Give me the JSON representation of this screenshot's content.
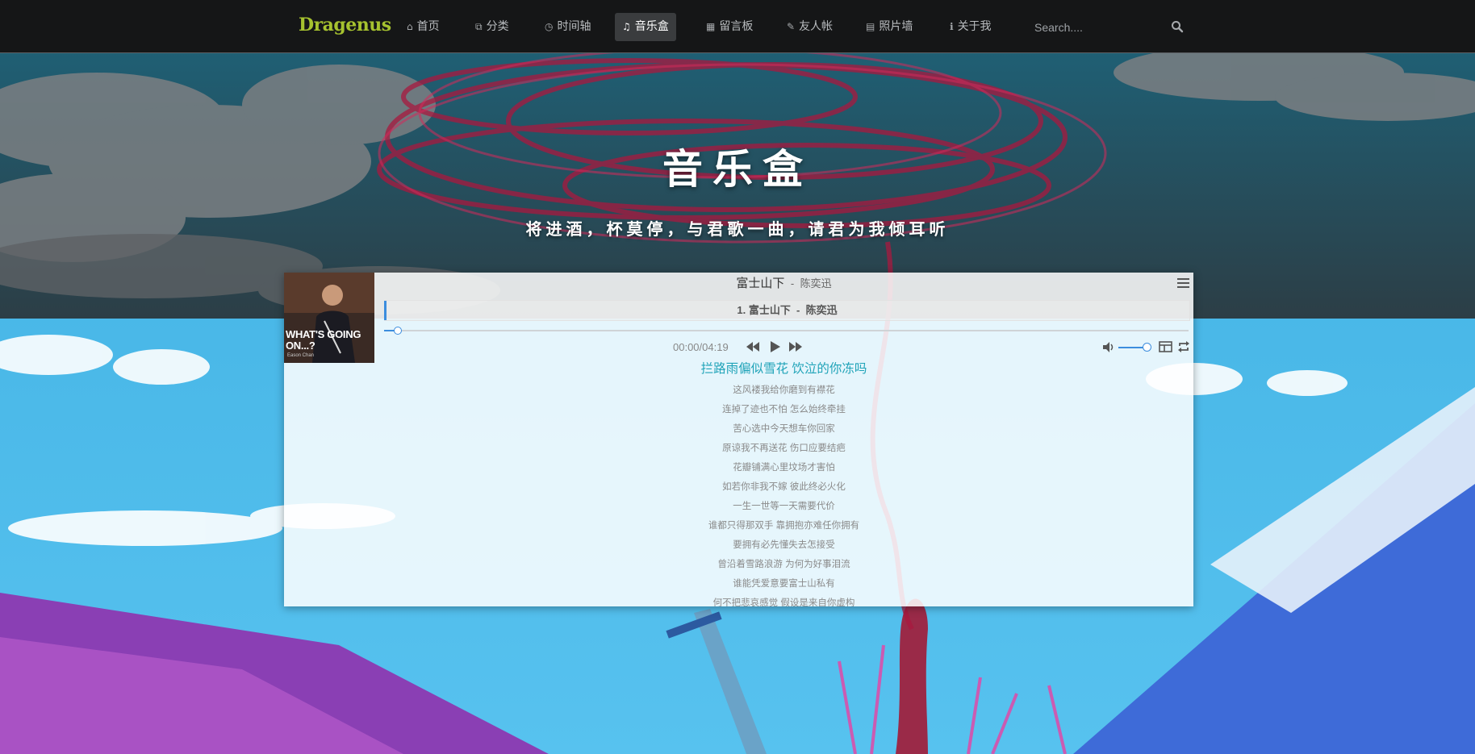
{
  "nav": {
    "brand": "Dragenus",
    "items": [
      {
        "label": "首页",
        "icon": "home-icon"
      },
      {
        "label": "分类",
        "icon": "copy-icon"
      },
      {
        "label": "时间轴",
        "icon": "clock-icon"
      },
      {
        "label": "音乐盒",
        "icon": "music-icon",
        "active": true
      },
      {
        "label": "留言板",
        "icon": "book-icon"
      },
      {
        "label": "友人帐",
        "icon": "pencil-icon"
      },
      {
        "label": "照片墙",
        "icon": "picture-icon"
      },
      {
        "label": "关于我",
        "icon": "info-icon"
      }
    ],
    "search_placeholder": "Search...."
  },
  "hero": {
    "title": "音乐盒",
    "subtitle": "将进酒，杯莫停，与君歌一曲，请君为我倾耳听"
  },
  "player": {
    "cover_text": "WHAT'S GOING ON...?",
    "cover_sub": "Eason Chan",
    "title": "富士山下",
    "separator": "-",
    "author": "陈奕迅",
    "playlist_item": "1. 富士山下  -  陈奕迅",
    "progress": 0.02,
    "time": "00:00/04:19",
    "volume": 0.85,
    "lyrics_current": "拦路雨偏似雪花 饮泣的你冻吗",
    "lyrics": [
      "这风褛我给你磨到有襟花",
      "连掉了迹也不怕 怎么始终牵挂",
      "苦心选中今天想车你回家",
      "原谅我不再送花 伤口应要结疤",
      "花瓣铺满心里坟场才害怕",
      "如若你非我不嫁 彼此终必火化",
      "一生一世等一天需要代价",
      "谁都只得那双手 靠拥抱亦难任你拥有",
      "要拥有必先懂失去怎接受",
      "曾沿着雪路浪游 为何为好事泪流",
      "谁能凭爱意要富士山私有",
      "何不把悲哀感觉 假设是来自你虚构"
    ]
  },
  "colors": {
    "navbar": "#151617",
    "brand": "#a6c22f",
    "accent": "#3c8dde",
    "lyric_current": "#1fa3b8"
  }
}
